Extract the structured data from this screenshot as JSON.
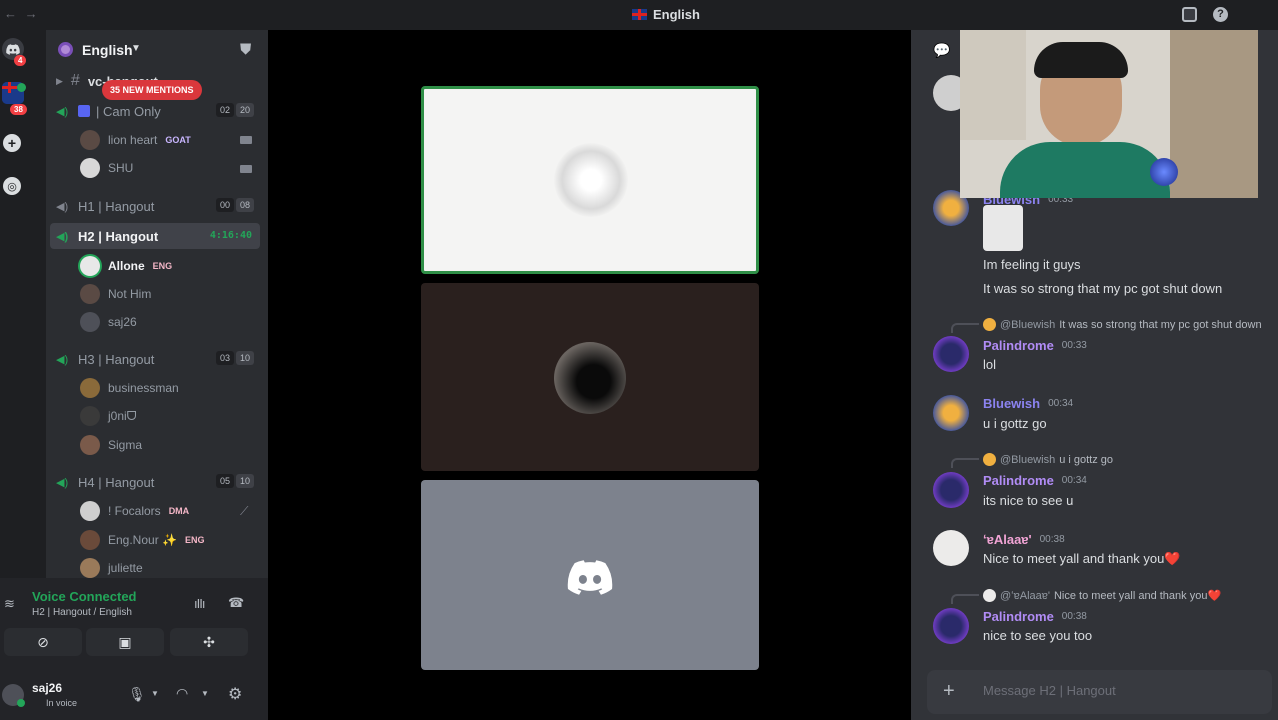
{
  "titlebar": {
    "title": "English"
  },
  "rail": {
    "dm_badge": "4",
    "server_badge": "38"
  },
  "server": {
    "name": "English"
  },
  "mentions": "35 NEW MENTIONS",
  "text_channel": "vc-hangout",
  "voice_channels": [
    {
      "name": "| Cam Only",
      "c1": "02",
      "c2": "20"
    },
    {
      "name": "H1 | Hangout",
      "c1": "00",
      "c2": "08"
    },
    {
      "name": "H2 | Hangout",
      "timer": "4:16:40"
    },
    {
      "name": "H3 | Hangout",
      "c1": "03",
      "c2": "10"
    },
    {
      "name": "H4 | Hangout",
      "c1": "05",
      "c2": "10"
    }
  ],
  "users": {
    "cam": [
      {
        "name": "lion heart",
        "tag": "GOAT"
      },
      {
        "name": "SHU"
      }
    ],
    "h2": [
      {
        "name": "Allone",
        "tag": "ENG"
      },
      {
        "name": "Not Him"
      },
      {
        "name": "saj26"
      }
    ],
    "h3": [
      {
        "name": "businessman"
      },
      {
        "name": "j0niᗜ"
      },
      {
        "name": "Sigma"
      }
    ],
    "h4": [
      {
        "name": "! Focalors",
        "tag": "DMA"
      },
      {
        "name": "Eng.Nour ✨",
        "tag": "ENG"
      },
      {
        "name": "juliette"
      }
    ]
  },
  "voice": {
    "status": "Voice Connected",
    "location": "H2 | Hangout / English"
  },
  "me": {
    "name": "saj26",
    "status": "In voice"
  },
  "messages": [
    {
      "author": "Bluewish",
      "time": "00:33",
      "lines": [
        "Im feeling it guys",
        "It was so strong that my pc got shut down"
      ],
      "color": "#8b83f0"
    },
    {
      "reply_to": "@Bluewish",
      "reply_text": "It was so strong that my pc got shut down",
      "author": "Palindrome",
      "time": "00:33",
      "text": "lol",
      "color": "#b18cf5"
    },
    {
      "author": "Bluewish",
      "time": "00:34",
      "text": "u i gottz go",
      "color": "#8b83f0"
    },
    {
      "reply_to": "@Bluewish",
      "reply_text": "u i gottz go",
      "author": "Palindrome",
      "time": "00:34",
      "text": "its nice to see u",
      "color": "#b18cf5"
    },
    {
      "author": "ʻɐAlaaɐ'",
      "time": "00:38",
      "text": "Nice to meet yall and thank you❤️",
      "color": "#f0a3d4"
    },
    {
      "reply_to": "@ʻɐAlaaɐ'",
      "reply_text": "Nice to meet yall and thank you❤️",
      "author": "Palindrome",
      "time": "00:38",
      "text": "nice to see you too",
      "color": "#b18cf5"
    }
  ],
  "composer": {
    "placeholder": "Message H2 | Hangout"
  },
  "colors": {
    "online": "#23a559",
    "accent": "#5865f2",
    "mention": "#da373c"
  }
}
